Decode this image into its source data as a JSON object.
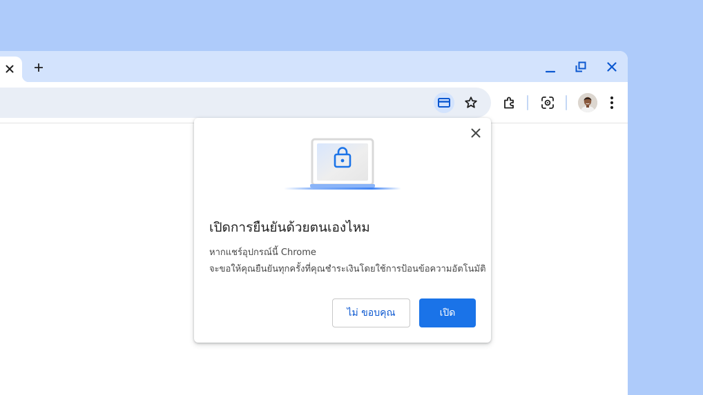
{
  "browser": {
    "tabstrip": {
      "close_tab_icon": "close-icon",
      "new_tab_icon": "plus-icon",
      "window_controls": [
        "minimize-icon",
        "restore-icon",
        "close-icon"
      ]
    },
    "toolbar": {
      "icons": [
        "card-icon",
        "star-icon",
        "extensions-icon",
        "lens-icon",
        "profile-avatar",
        "more-vert-icon"
      ]
    }
  },
  "dialog": {
    "title": "เปิดการยืนยันด้วยตนเองไหม",
    "body_line1": "หากแชร์อุปกรณ์นี้ Chrome",
    "body_line2": "จะขอให้คุณยืนยันทุกครั้งที่คุณชำระเงินโดยใช้การป้อนข้อความอัตโนมัติ",
    "cancel_label": "ไม่ ขอบคุณ",
    "confirm_label": "เปิด",
    "illustration": "laptop-lock-icon"
  },
  "colors": {
    "desktop": "#aecbfa",
    "tabstrip": "#d3e3fd",
    "omnibox": "#e9eef6",
    "accent": "#0b57d0",
    "primary_button": "#1a73e8"
  }
}
